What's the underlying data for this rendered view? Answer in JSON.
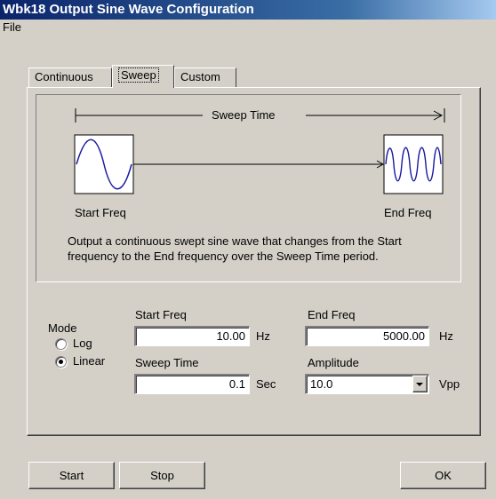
{
  "window": {
    "title": "Wbk18 Output Sine Wave Configuration"
  },
  "menu": {
    "file_label": "File"
  },
  "tabs": [
    {
      "label": "Continuous",
      "active": false
    },
    {
      "label": "Sweep",
      "active": true
    },
    {
      "label": "Custom",
      "active": false
    }
  ],
  "diagram": {
    "sweep_time_label": "Sweep Time",
    "start_freq_label": "Start Freq",
    "end_freq_label": "End Freq",
    "description": "Output a continuous swept sine wave that changes from the Start frequency to the End frequency over the Sweep Time period."
  },
  "mode": {
    "label": "Mode",
    "options": [
      {
        "label": "Log",
        "selected": false
      },
      {
        "label": "Linear",
        "selected": true
      }
    ]
  },
  "fields": {
    "start_freq": {
      "label": "Start Freq",
      "value": "10.00",
      "unit": "Hz"
    },
    "end_freq": {
      "label": "End Freq",
      "value": "5000.00",
      "unit": "Hz"
    },
    "sweep_time": {
      "label": "Sweep Time",
      "value": "0.1",
      "unit": "Sec"
    },
    "amplitude": {
      "label": "Amplitude",
      "value": "10.0",
      "unit": "Vpp"
    }
  },
  "buttons": {
    "start": "Start",
    "stop": "Stop",
    "ok": "OK"
  },
  "colors": {
    "title_bar": "#0a246a",
    "waveform": "#1a1aa0",
    "window_bg": "#d4d0c8"
  }
}
